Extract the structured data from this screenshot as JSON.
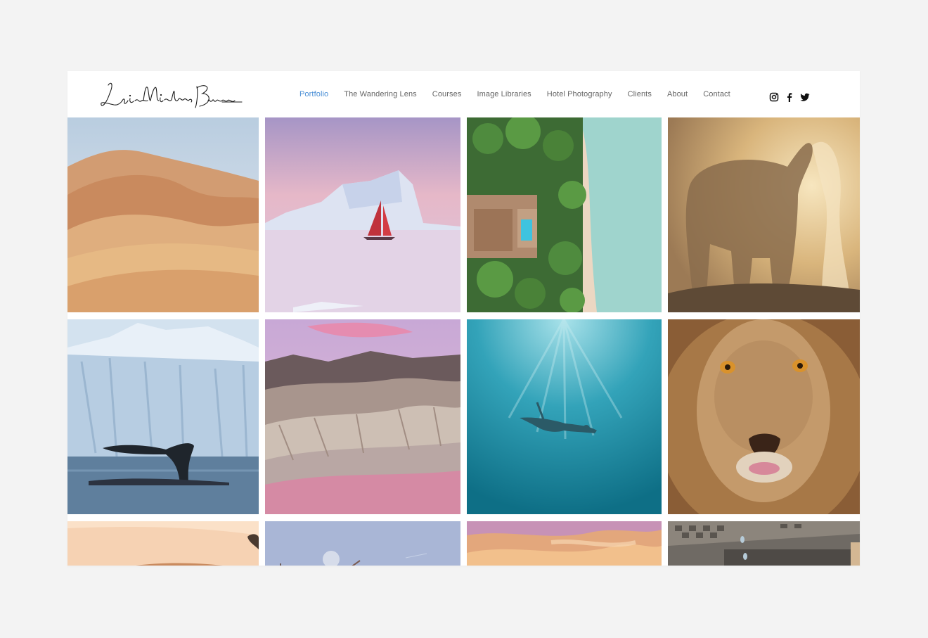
{
  "logo": {
    "text": "Lisa Michele Burns"
  },
  "nav": {
    "items": [
      {
        "label": "Portfolio",
        "active": true
      },
      {
        "label": "The Wandering Lens",
        "active": false
      },
      {
        "label": "Courses",
        "active": false
      },
      {
        "label": "Image Libraries",
        "active": false
      },
      {
        "label": "Hotel Photography",
        "active": false
      },
      {
        "label": "Clients",
        "active": false
      },
      {
        "label": "About",
        "active": false
      },
      {
        "label": "Contact",
        "active": false
      }
    ],
    "active_color": "#4a8fd6"
  },
  "social": {
    "icons": [
      "instagram-icon",
      "facebook-icon",
      "twitter-icon"
    ]
  },
  "gallery": {
    "photos": [
      "desert-dunes-photo",
      "iceberg-red-sailboat-photo",
      "aerial-beach-resort-pool-photo",
      "elephant-dust-photo",
      "whale-tail-glacier-photo",
      "badlands-mountains-pink-sky-photo",
      "underwater-swimmer-photo",
      "lion-face-photo",
      "sand-dune-partial-photo",
      "sailboat-moon-partial-photo",
      "pink-clouds-partial-photo",
      "interior-ceiling-partial-photo"
    ]
  }
}
